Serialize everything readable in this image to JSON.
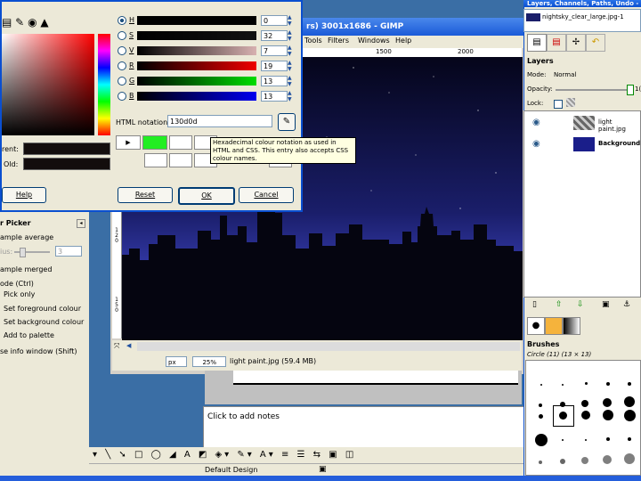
{
  "image_window": {
    "title": "rs) 3001x1686 - GIMP",
    "menu": [
      "Tools",
      "Filters",
      "Windows",
      "Help"
    ],
    "ruler_marks": [
      "1500",
      "2000"
    ],
    "vertical_ruler": [
      "1",
      "2",
      "0",
      "1",
      "5",
      "0"
    ],
    "unit": "px",
    "zoom": "25%",
    "status": "light paint.jpg (59.4 MB)"
  },
  "color_dialog": {
    "channels": [
      {
        "label": "H",
        "value": "0"
      },
      {
        "label": "S",
        "value": "32"
      },
      {
        "label": "V",
        "value": "7"
      },
      {
        "label": "R",
        "value": "19"
      },
      {
        "label": "G",
        "value": "13"
      },
      {
        "label": "B",
        "value": "13"
      }
    ],
    "html_notation_label": "HTML notation:",
    "html_notation_value": "130d0d",
    "tooltip": "Hexadecimal colour notation as used in HTML and CSS.  This entry also accepts CSS colour names.",
    "current_label": "rent:",
    "old_label": "Old:",
    "buttons": {
      "help": "Help",
      "reset": "Reset",
      "ok": "OK",
      "cancel": "Cancel"
    },
    "colors": {
      "current": "#130d0d",
      "history_green": "#22ee22"
    }
  },
  "tool_options": {
    "title": "r Picker",
    "sample_average": "ample average",
    "radius_label": "ius:",
    "radius_value": "3",
    "sample_merged": "ample merged",
    "mode_label": "ode  (Ctrl)",
    "options": [
      "Pick only",
      "Set foreground colour",
      "Set background colour",
      "Add to palette"
    ],
    "info_window": "se info window  (Shift)"
  },
  "notes": {
    "placeholder": "Click to add notes"
  },
  "bottom": {
    "style": "Default Design"
  },
  "layers_panel": {
    "title": "Layers, Channels, Paths, Undo -",
    "image_select": "nightsky_clear_large.jpg-1",
    "section": "Layers",
    "mode_label": "Mode:",
    "mode_value": "Normal",
    "opacity_label": "Opacity:",
    "opacity_value": "1(",
    "lock_label": "Lock:",
    "layers": [
      {
        "name": "light paint.jpg",
        "bold": false
      },
      {
        "name": "Background",
        "bold": true
      }
    ]
  },
  "brushes": {
    "title": "Brushes",
    "selected": "Circle (11) (13 × 13)"
  }
}
